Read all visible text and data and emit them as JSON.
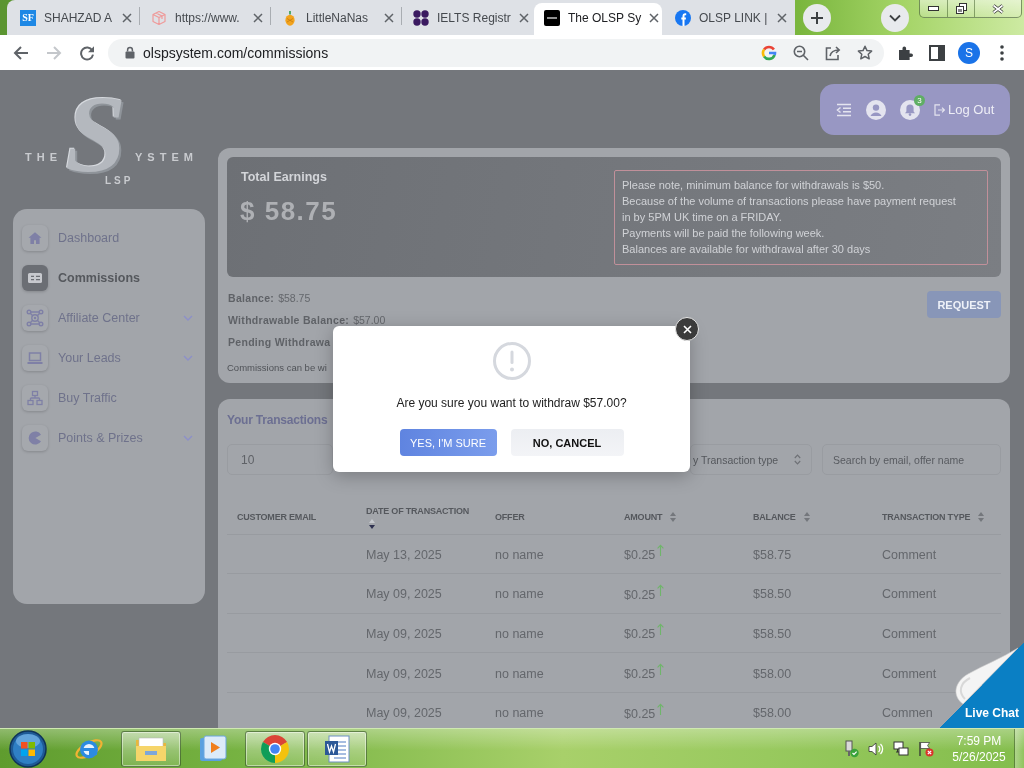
{
  "browser": {
    "tabs": [
      {
        "title": "SHAHZAD A",
        "selected": false,
        "favicon_text": "SF"
      },
      {
        "title": "https://www.",
        "selected": false
      },
      {
        "title": "LittleNaNas",
        "selected": false
      },
      {
        "title": "IELTS Registr",
        "selected": false
      },
      {
        "title": "The OLSP Sy",
        "selected": true
      },
      {
        "title": "OLSP LINK |",
        "selected": false
      }
    ],
    "back": {
      "disabled": false
    },
    "forward": {
      "disabled": true
    },
    "url": "olspsystem.com/commissions",
    "profile_initial": "S"
  },
  "logo": {
    "left": "THE",
    "letter": "S",
    "right": "YSTEM",
    "sub": "LSP"
  },
  "header": {
    "notification_count": "3",
    "logout": "Log Out"
  },
  "sidebar": {
    "items": [
      {
        "label": "Dashboard",
        "selected": false,
        "submenu": false
      },
      {
        "label": "Commissions",
        "selected": true,
        "submenu": false
      },
      {
        "label": "Affiliate Center",
        "selected": false,
        "submenu": true
      },
      {
        "label": "Your Leads",
        "selected": false,
        "submenu": true
      },
      {
        "label": "Buy Traffic",
        "selected": false,
        "submenu": false
      },
      {
        "label": "Points & Prizes",
        "selected": false,
        "submenu": true
      }
    ]
  },
  "earnings": {
    "title": "Total Earnings",
    "amount": "$ 58.75",
    "notice": [
      "Please note, minimum balance for withdrawals is $50.",
      "Because of the volume of transactions please have payment request in by 5PM UK time on a FRIDAY.",
      "Payments will be paid the following week.",
      "Balances are available for withdrawal after 30 days"
    ]
  },
  "balances": [
    {
      "label": "Balance:",
      "value": "$58.75"
    },
    {
      "label": "Withdrawable Balance:",
      "value": "$57.00"
    },
    {
      "label": "Pending Withdrawa"
    }
  ],
  "balance_note": "Commissions can be wi",
  "request_button": "REQUEST",
  "transactions": {
    "title": "Your Transactions",
    "page_size": "10",
    "type_filter": "y Transaction type",
    "search_placeholder": "Search by email, offer name",
    "columns": [
      {
        "label": "CUSTOMER EMAIL",
        "sortable": false
      },
      {
        "label": "DATE OF TRANSACTION",
        "sortable": true,
        "sorted": true
      },
      {
        "label": "OFFER",
        "sortable": false
      },
      {
        "label": "AMOUNT",
        "sortable": true,
        "sorted": false
      },
      {
        "label": "BALANCE",
        "sortable": true,
        "sorted": false
      },
      {
        "label": "TRANSACTION TYPE",
        "sortable": true,
        "sorted": false
      }
    ],
    "rows": [
      {
        "date": "May 13, 2025",
        "offer": "no name",
        "amount": "$0.25",
        "increase": true,
        "balance": "$58.75",
        "type": "Comment"
      },
      {
        "date": "May 09, 2025",
        "offer": "no name",
        "amount": "$0.25",
        "increase": true,
        "balance": "$58.50",
        "type": "Comment"
      },
      {
        "date": "May 09, 2025",
        "offer": "no name",
        "amount": "$0.25",
        "increase": true,
        "balance": "$58.50",
        "type": "Comment"
      },
      {
        "date": "May 09, 2025",
        "offer": "no name",
        "amount": "$0.25",
        "increase": true,
        "balance": "$58.00",
        "type": "Comment"
      },
      {
        "date": "May 09, 2025",
        "offer": "no name",
        "amount": "$0.25",
        "increase": true,
        "balance": "$58.00",
        "type": "Commen"
      }
    ]
  },
  "dialog": {
    "message": "Are you sure you want to withdraw $57.00?",
    "confirm": "YES, I'M SURE",
    "cancel": "NO, CANCEL"
  },
  "live_chat": "Live Chat",
  "taskbar": {
    "apps": [
      {
        "running": false
      },
      {
        "running": true
      },
      {
        "running": false
      },
      {
        "running": true
      },
      {
        "running": true
      }
    ],
    "time": "7:59 PM",
    "date": "5/26/2025"
  }
}
